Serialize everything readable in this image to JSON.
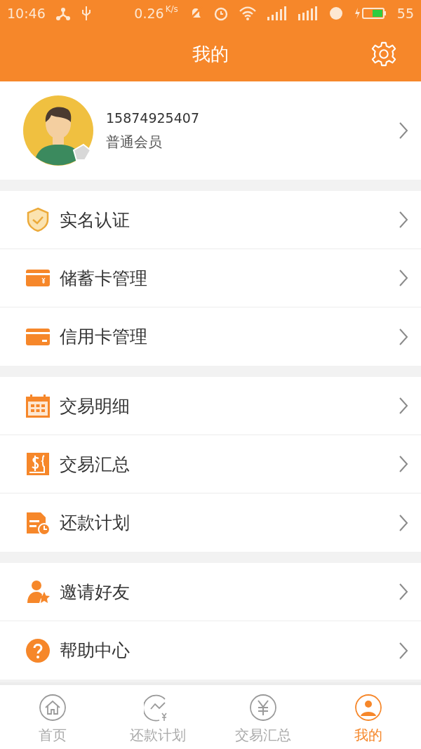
{
  "status_bar": {
    "time": "10:46",
    "speed": "0.26",
    "speed_unit": "K/s",
    "battery": "55"
  },
  "header": {
    "title": "我的"
  },
  "profile": {
    "phone": "15874925407",
    "level": "普通会员"
  },
  "menu_groups": [
    {
      "items": [
        {
          "kind": "shield",
          "label": "实名认证"
        },
        {
          "kind": "debit-card",
          "label": "储蓄卡管理"
        },
        {
          "kind": "credit-card",
          "label": "信用卡管理"
        }
      ]
    },
    {
      "items": [
        {
          "kind": "calendar",
          "label": "交易明细"
        },
        {
          "kind": "dollar",
          "label": "交易汇总"
        },
        {
          "kind": "plan",
          "label": "还款计划"
        }
      ]
    },
    {
      "items": [
        {
          "kind": "invite",
          "label": "邀请好友"
        },
        {
          "kind": "help",
          "label": "帮助中心"
        }
      ]
    }
  ],
  "tabs": [
    {
      "kind": "home",
      "label": "首页",
      "selected": false
    },
    {
      "kind": "plan",
      "label": "还款计划",
      "selected": false
    },
    {
      "kind": "yuan",
      "label": "交易汇总",
      "selected": false
    },
    {
      "kind": "me",
      "label": "我的",
      "selected": true
    }
  ]
}
